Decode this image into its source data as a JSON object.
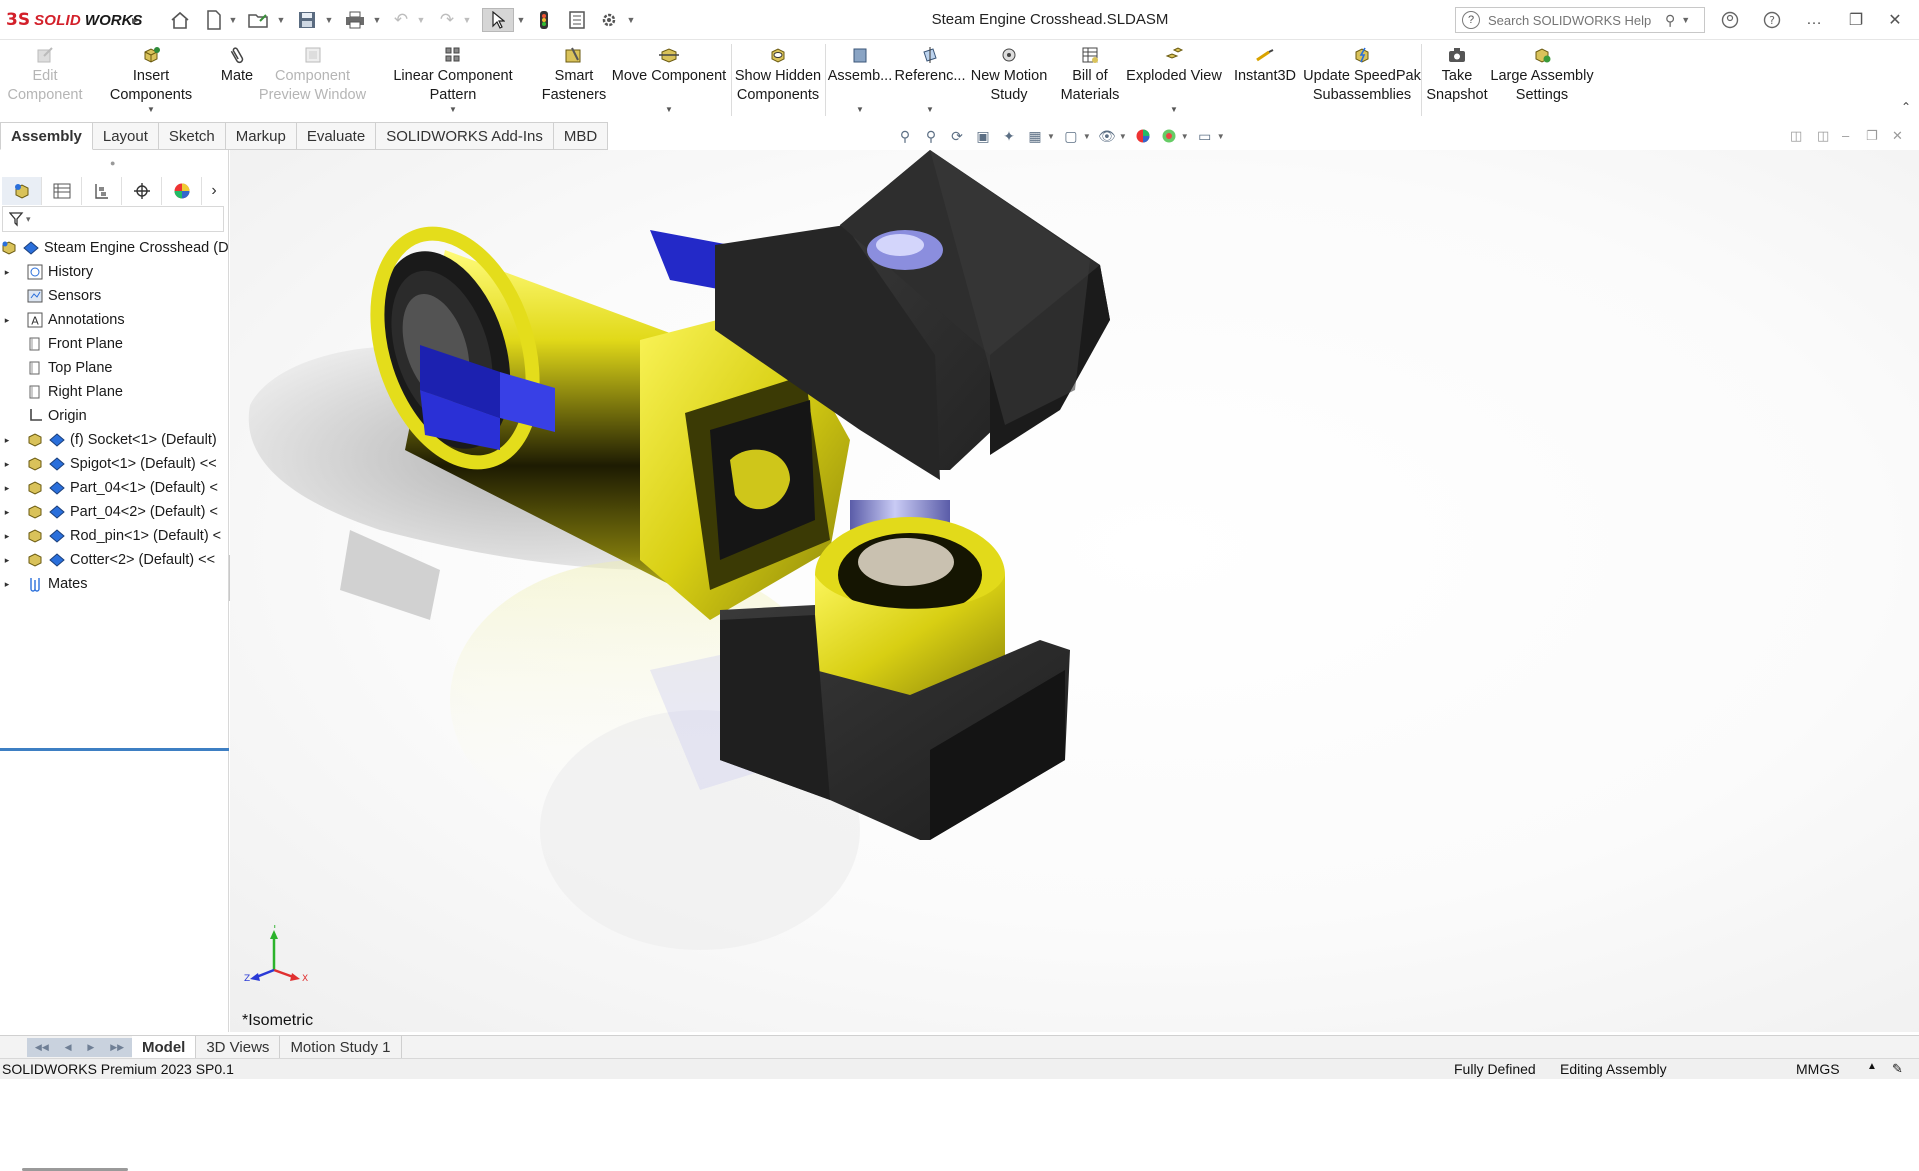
{
  "app": {
    "brand_ds": "3S",
    "brand_solid": "SOLID",
    "brand_works": "WORKS",
    "document_title": "Steam Engine Crosshead.SLDASM",
    "search_placeholder": "Search SOLIDWORKS Help"
  },
  "ribbon": [
    {
      "id": "edit-component",
      "label": "Edit\nComponent",
      "enabled": false,
      "icon": "edit-component-icon"
    },
    {
      "id": "insert-components",
      "label": "Insert Components",
      "enabled": true,
      "icon": "insert-components-icon"
    },
    {
      "id": "mate",
      "label": "Mate",
      "enabled": true,
      "icon": "mate-paperclip-icon"
    },
    {
      "id": "component-preview-window",
      "label": "Component\nPreview Window",
      "enabled": false,
      "icon": "preview-window-icon"
    },
    {
      "id": "linear-component-pattern",
      "label": "Linear Component Pattern",
      "enabled": true,
      "icon": "linear-pattern-icon"
    },
    {
      "id": "smart-fasteners",
      "label": "Smart\nFasteners",
      "enabled": true,
      "icon": "smart-fasteners-icon"
    },
    {
      "id": "move-component",
      "label": "Move Component",
      "enabled": true,
      "icon": "move-component-icon"
    },
    {
      "id": "show-hidden-components",
      "label": "Show Hidden\nComponents",
      "enabled": true,
      "icon": "show-hidden-icon"
    },
    {
      "id": "assembly-features",
      "label": "Assemb...",
      "enabled": true,
      "icon": "assembly-features-icon"
    },
    {
      "id": "reference-geometry",
      "label": "Referenc...",
      "enabled": true,
      "icon": "reference-geometry-icon"
    },
    {
      "id": "new-motion-study",
      "label": "New Motion\nStudy",
      "enabled": true,
      "icon": "motion-study-icon"
    },
    {
      "id": "bill-of-materials",
      "label": "Bill of\nMaterials",
      "enabled": true,
      "icon": "bill-of-materials-icon"
    },
    {
      "id": "exploded-view",
      "label": "Exploded View",
      "enabled": true,
      "icon": "exploded-view-icon"
    },
    {
      "id": "instant3d",
      "label": "Instant3D",
      "enabled": true,
      "icon": "instant3d-icon"
    },
    {
      "id": "update-speedpak",
      "label": "Update SpeedPak\nSubassemblies",
      "enabled": true,
      "icon": "speedpak-icon"
    },
    {
      "id": "take-snapshot",
      "label": "Take\nSnapshot",
      "enabled": true,
      "icon": "camera-icon"
    },
    {
      "id": "large-assembly-settings",
      "label": "Large Assembly\nSettings",
      "enabled": true,
      "icon": "large-assembly-icon"
    }
  ],
  "command_tabs": [
    "Assembly",
    "Layout",
    "Sketch",
    "Markup",
    "Evaluate",
    "SOLIDWORKS Add-Ins",
    "MBD"
  ],
  "active_command_tab": "Assembly",
  "feature_tree": {
    "root": "Steam Engine Crosshead (D",
    "items": [
      {
        "label": "History",
        "icon": "history-icon",
        "expandable": true
      },
      {
        "label": "Sensors",
        "icon": "sensors-icon",
        "expandable": false
      },
      {
        "label": "Annotations",
        "icon": "annotations-icon",
        "expandable": true
      },
      {
        "label": "Front Plane",
        "icon": "plane-icon",
        "expandable": false
      },
      {
        "label": "Top Plane",
        "icon": "plane-icon",
        "expandable": false
      },
      {
        "label": "Right Plane",
        "icon": "plane-icon",
        "expandable": false
      },
      {
        "label": "Origin",
        "icon": "origin-icon",
        "expandable": false
      },
      {
        "label": "(f) Socket<1> (Default)",
        "icon": "part-icon",
        "expandable": true
      },
      {
        "label": "Spigot<1> (Default) <<",
        "icon": "part-icon",
        "expandable": true
      },
      {
        "label": "Part_04<1> (Default) <",
        "icon": "part-icon",
        "expandable": true
      },
      {
        "label": "Part_04<2> (Default) <",
        "icon": "part-icon",
        "expandable": true
      },
      {
        "label": "Rod_pin<1> (Default) <",
        "icon": "part-icon",
        "expandable": true
      },
      {
        "label": "Cotter<2> (Default) <<",
        "icon": "part-icon",
        "expandable": true
      },
      {
        "label": "Mates",
        "icon": "mates-icon",
        "expandable": true
      }
    ]
  },
  "viewport": {
    "view_label": "*Isometric",
    "triad": {
      "x": "X",
      "y": "Y",
      "z": "Z"
    }
  },
  "bottom_tabs": [
    "Model",
    "3D Views",
    "Motion Study 1"
  ],
  "active_bottom_tab": "Model",
  "status": {
    "product": "SOLIDWORKS Premium 2023 SP0.1",
    "defined": "Fully Defined",
    "mode": "Editing Assembly",
    "units": "MMGS"
  },
  "colors": {
    "brand_red": "#d3202a",
    "tree_selection_line": "#3e7fc3",
    "yellow_part": "#e7e01b",
    "blue_part": "#2329c8",
    "black_part": "#2a2a2a",
    "pin_lavender": "#9c9fe0"
  }
}
